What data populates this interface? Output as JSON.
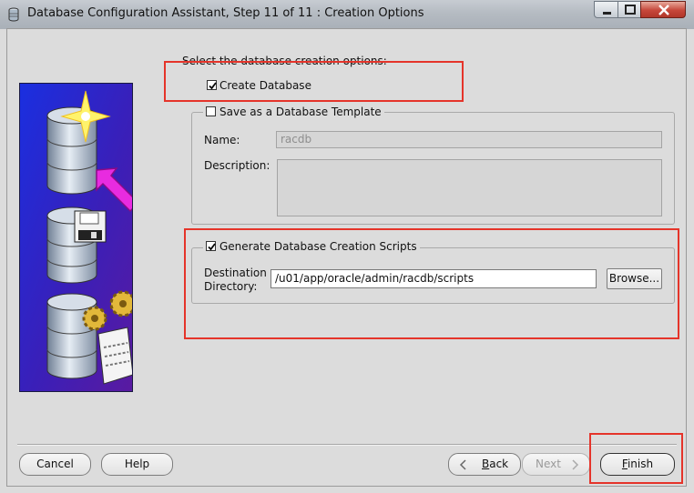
{
  "window": {
    "title": "Database Configuration Assistant, Step 11 of 11 : Creation Options"
  },
  "creation_options": {
    "prompt": "Select the database creation options:",
    "create_database": {
      "label": "Create Database",
      "checked": true
    },
    "save_template": {
      "label": "Save as a Database Template",
      "checked": false,
      "name_label": "Name:",
      "name_value": "racdb",
      "description_label": "Description:",
      "description_value": ""
    },
    "generate_scripts": {
      "label": "Generate Database Creation Scripts",
      "checked": true,
      "destination_label_line1": "Destination",
      "destination_label_line2": "Directory:",
      "destination_value": "/u01/app/oracle/admin/racdb/scripts",
      "browse_label": "Browse..."
    }
  },
  "buttons": {
    "cancel": "Cancel",
    "help": "Help",
    "back": "Back",
    "next": "Next",
    "finish": "Finish"
  },
  "icons": [
    "app-icon",
    "minimize-icon",
    "maximize-icon",
    "close-icon",
    "back-arrow-icon",
    "next-arrow-icon",
    "checkmark-icon"
  ],
  "colors": {
    "annotation_red": "#e5342a",
    "side_panel_blue": "#1f2ec8",
    "side_panel_purple": "#6a1aa8"
  }
}
